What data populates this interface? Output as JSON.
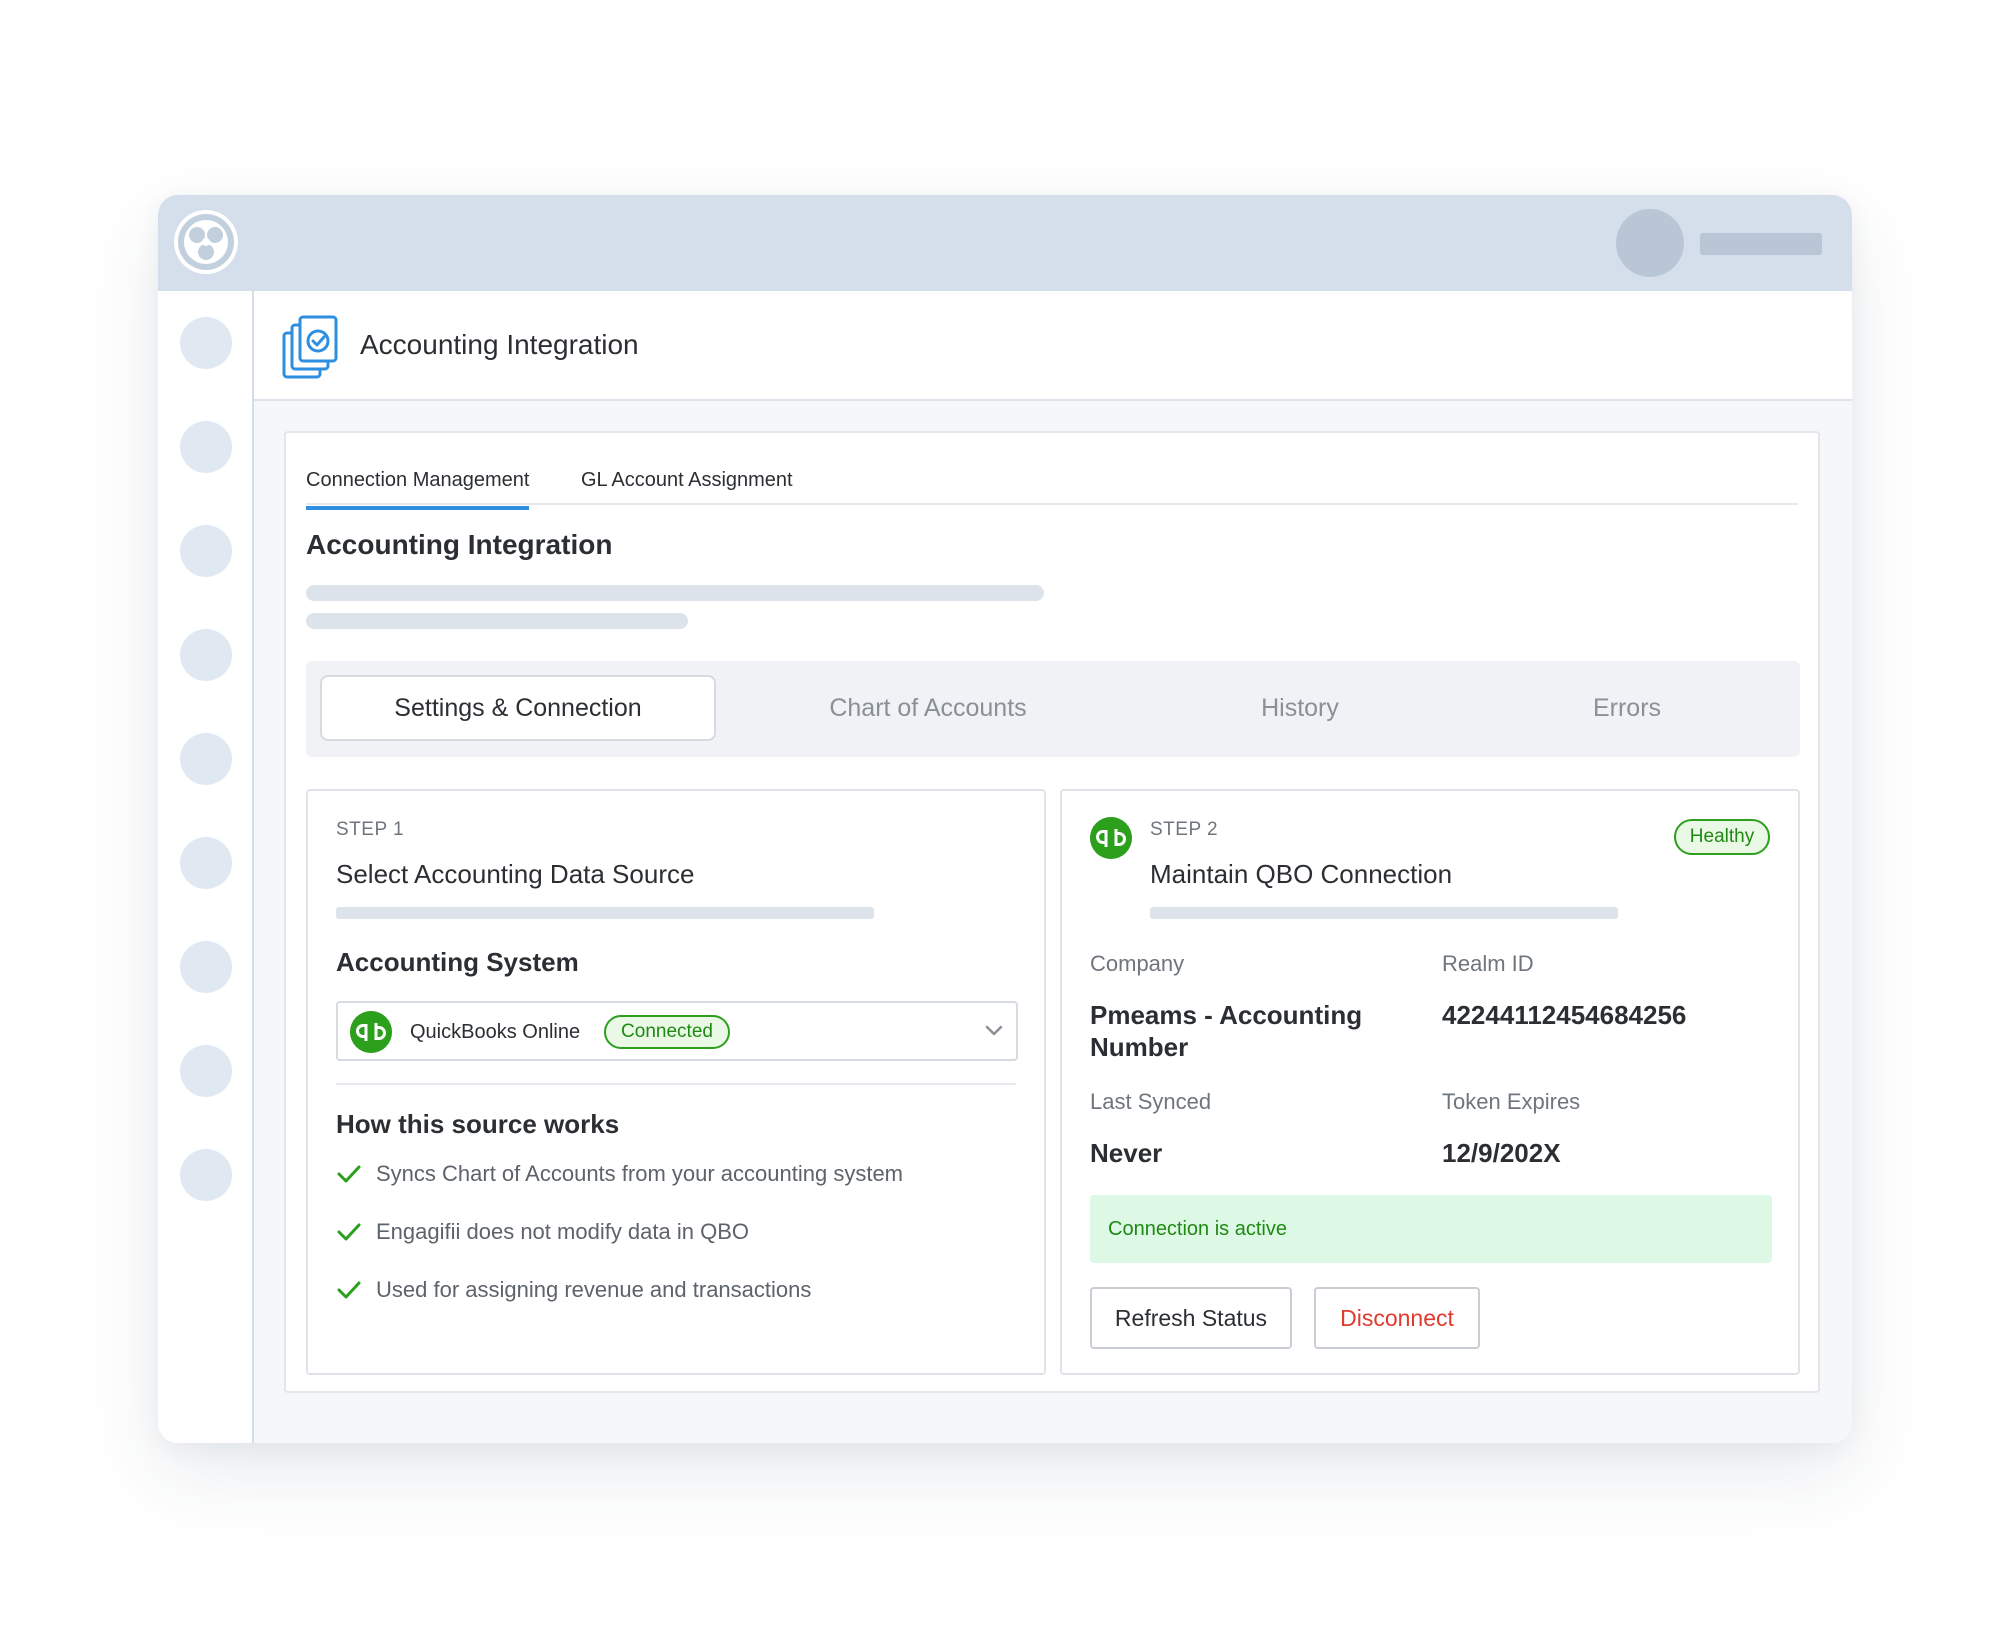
{
  "header": {
    "title": "Accounting Integration"
  },
  "tabs_top": [
    {
      "label": "Connection Management",
      "active": true
    },
    {
      "label": "GL Account Assignment",
      "active": false
    }
  ],
  "section": {
    "title": "Accounting Integration"
  },
  "segments": [
    {
      "label": "Settings & Connection",
      "active": true
    },
    {
      "label": "Chart of Accounts",
      "active": false
    },
    {
      "label": "History",
      "active": false
    },
    {
      "label": "Errors",
      "active": false
    }
  ],
  "step1": {
    "label": "STEP 1",
    "title": "Select Accounting Data Source",
    "system_heading": "Accounting System",
    "select_value": "QuickBooks Online",
    "select_badge": "Connected",
    "how_heading": "How this source works",
    "checks": [
      "Syncs Chart of Accounts from your accounting system",
      "Engagifii does not modify data in QBO",
      "Used for assigning revenue and transactions"
    ]
  },
  "step2": {
    "label": "STEP 2",
    "title": "Maintain QBO Connection",
    "status_badge": "Healthy",
    "company_label": "Company",
    "company_value": "Pmeams - Accounting Number",
    "realm_label": "Realm ID",
    "realm_value": "42244112454684256",
    "last_synced_label": "Last Synced",
    "last_synced_value": "Never",
    "token_label": "Token Expires",
    "token_value": "12/9/202X",
    "alert": "Connection is active",
    "refresh_label": "Refresh Status",
    "disconnect_label": "Disconnect"
  },
  "colors": {
    "accent": "#2e8fe0",
    "success": "#2ca01c",
    "danger": "#e03a2f",
    "topbar": "#d4dfeb"
  },
  "icons": {
    "app_logo": "app-logo-icon",
    "page": "accounting-documents-icon",
    "quickbooks": "quickbooks-icon",
    "check": "check-icon",
    "chevron": "chevron-down-icon"
  }
}
